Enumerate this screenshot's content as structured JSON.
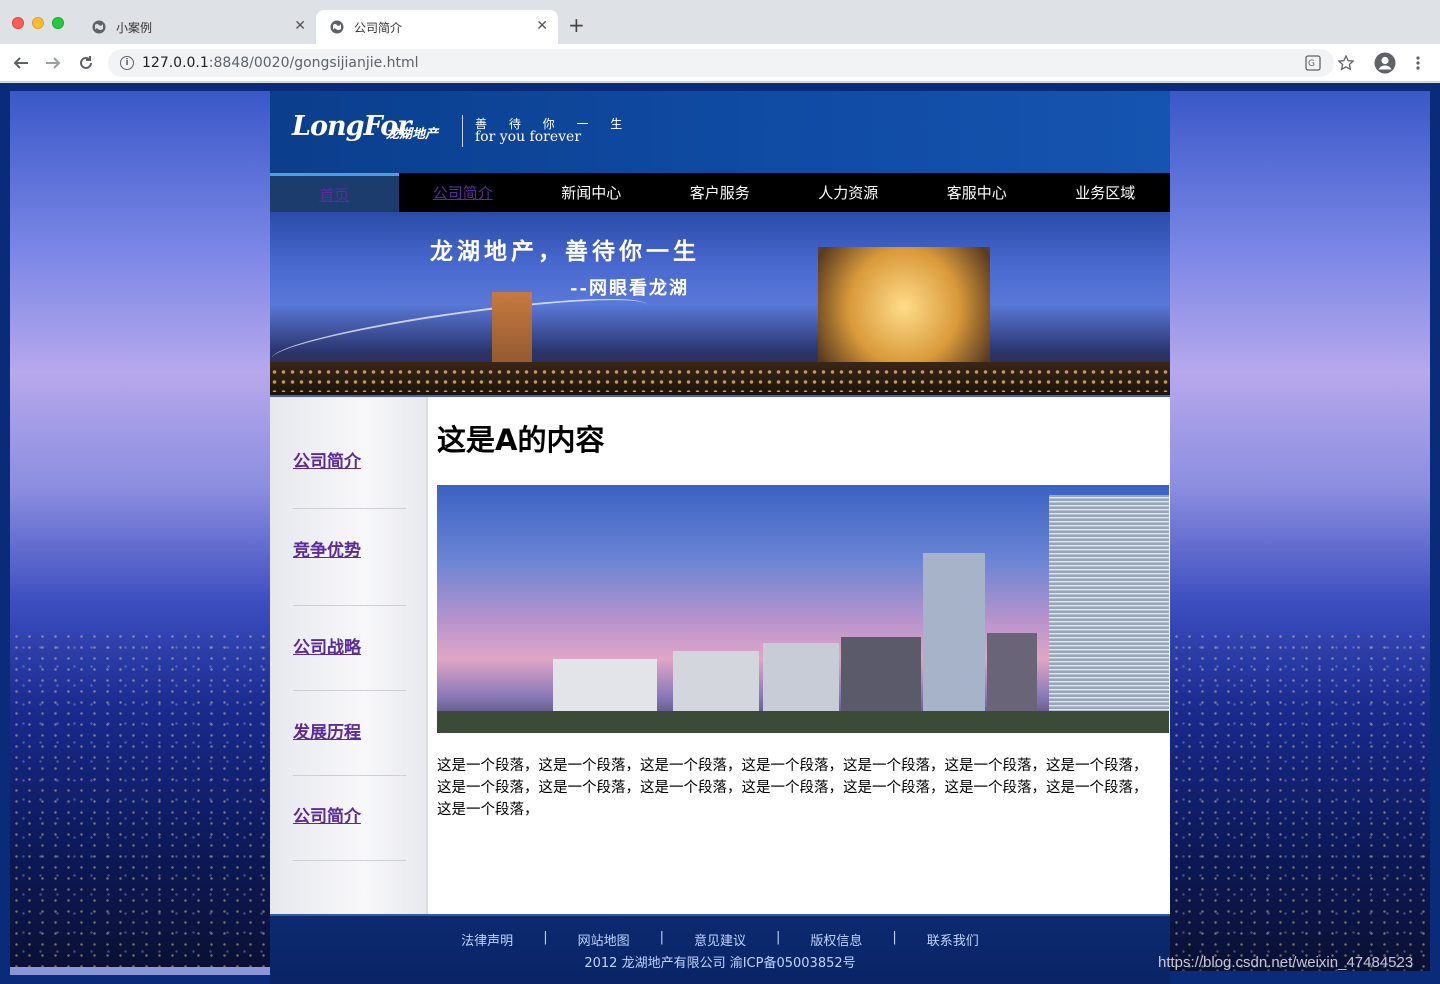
{
  "browser": {
    "tabs": [
      {
        "title": "小案例",
        "active": false
      },
      {
        "title": "公司简介",
        "active": true
      }
    ],
    "url_host": "127.0.0.1",
    "url_path": ":8848/0020/gongsijianjie.html",
    "icons": [
      "back-icon",
      "forward-icon",
      "reload-icon",
      "info-icon",
      "translate-icon",
      "star-icon",
      "profile-icon",
      "menu-icon"
    ]
  },
  "header": {
    "logo_text": "LongFor",
    "logo_cn": "龙湖地产",
    "slogan_cn": "善 待 你 一 生",
    "slogan_en": "for you forever"
  },
  "nav": {
    "items": [
      "首页",
      "公司简介",
      "新闻中心",
      "客户服务",
      "人力资源",
      "客服中心",
      "业务区域"
    ]
  },
  "banner": {
    "line1": "龙湖地产，善待你一生",
    "line2": "--网眼看龙湖"
  },
  "sidebar": {
    "items": [
      "公司简介",
      "竞争优势",
      "公司战略",
      "发展历程",
      "公司简介"
    ]
  },
  "content": {
    "heading": "这是A的内容",
    "paragraph": "这是一个段落，这是一个段落，这是一个段落，这是一个段落，这是一个段落，这是一个段落，这是一个段落，这是一个段落，这是一个段落，这是一个段落，这是一个段落，这是一个段落，这是一个段落，这是一个段落，这是一个段落，"
  },
  "footer": {
    "links": [
      "法律声明",
      "网站地图",
      "意见建议",
      "版权信息",
      "联系我们"
    ],
    "separator": "|",
    "copyright": "2012 龙湖地产有限公司 渝ICP备05003852号"
  },
  "watermark": "https://blog.csdn.net/weixin_47484523",
  "colors": {
    "header_blue": "#0f4aa2",
    "nav_black": "#000000",
    "visited_link": "#5a2b9a",
    "footer_text": "#bfd4ff"
  }
}
